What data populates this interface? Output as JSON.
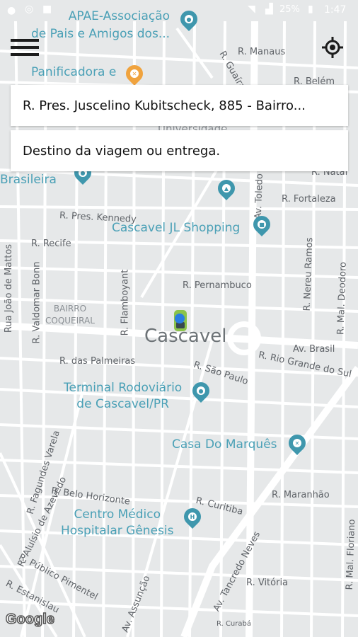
{
  "status_bar": {
    "time": "1:47",
    "battery": "25%"
  },
  "map": {
    "city_label": "Cascavel",
    "neighborhood_label": "BAIRRO\nCOQUEIRAL",
    "pois": [
      {
        "name": "APAE-Associação\nde Pais e Amigos dos...",
        "type": "pin"
      },
      {
        "name": "Panificadora e",
        "type": "restaurant"
      },
      {
        "name": "Universidade",
        "type": "school"
      },
      {
        "name": "Brasileira",
        "type": "pin"
      },
      {
        "name": "Cascavel JL Shopping",
        "type": "shopping"
      },
      {
        "name": "Terminal Rodoviário\nde Cascavel/PR",
        "type": "pin"
      },
      {
        "name": "Casa Do Marquês",
        "type": "restaurant"
      },
      {
        "name": "Centro Médico\nHospitalar Gênesis",
        "type": "hospital"
      }
    ],
    "streets": [
      "R. Manaus",
      "R. Belém",
      "R. Fortaleza",
      "R. Pres. Kennedy",
      "R. Recife",
      "R. Pernambuco",
      "Av. Brasil",
      "R. das Palmeiras",
      "R. São Paulo",
      "R. Rio Grande do Sul",
      "R. Maranhão",
      "R. Belo Horizonte",
      "R. Curitiba",
      "R. Vitória",
      "R. Público Pimentel",
      "R. Estanislau",
      "Av. Assunção",
      "Av. Tancredo Neves",
      "R. Curabá",
      "R. Flamboyant",
      "Rua João de Mattos",
      "R. Valdomar Bonn",
      "R. Fagundes Varela",
      "R. Aluísio de Azevedo",
      "R. Nereu Ramos",
      "R. Mal. Deodoro",
      "R. Mal. Floriano",
      "Av. Toledo",
      "R. Natal",
      "R. Guaíra"
    ]
  },
  "origin_field": {
    "value": "R. Pres. Juscelino Kubitscheck, 885 - Bairro..."
  },
  "destination_field": {
    "placeholder": "Destino da viagem ou entrega."
  },
  "attribution": "Google"
}
